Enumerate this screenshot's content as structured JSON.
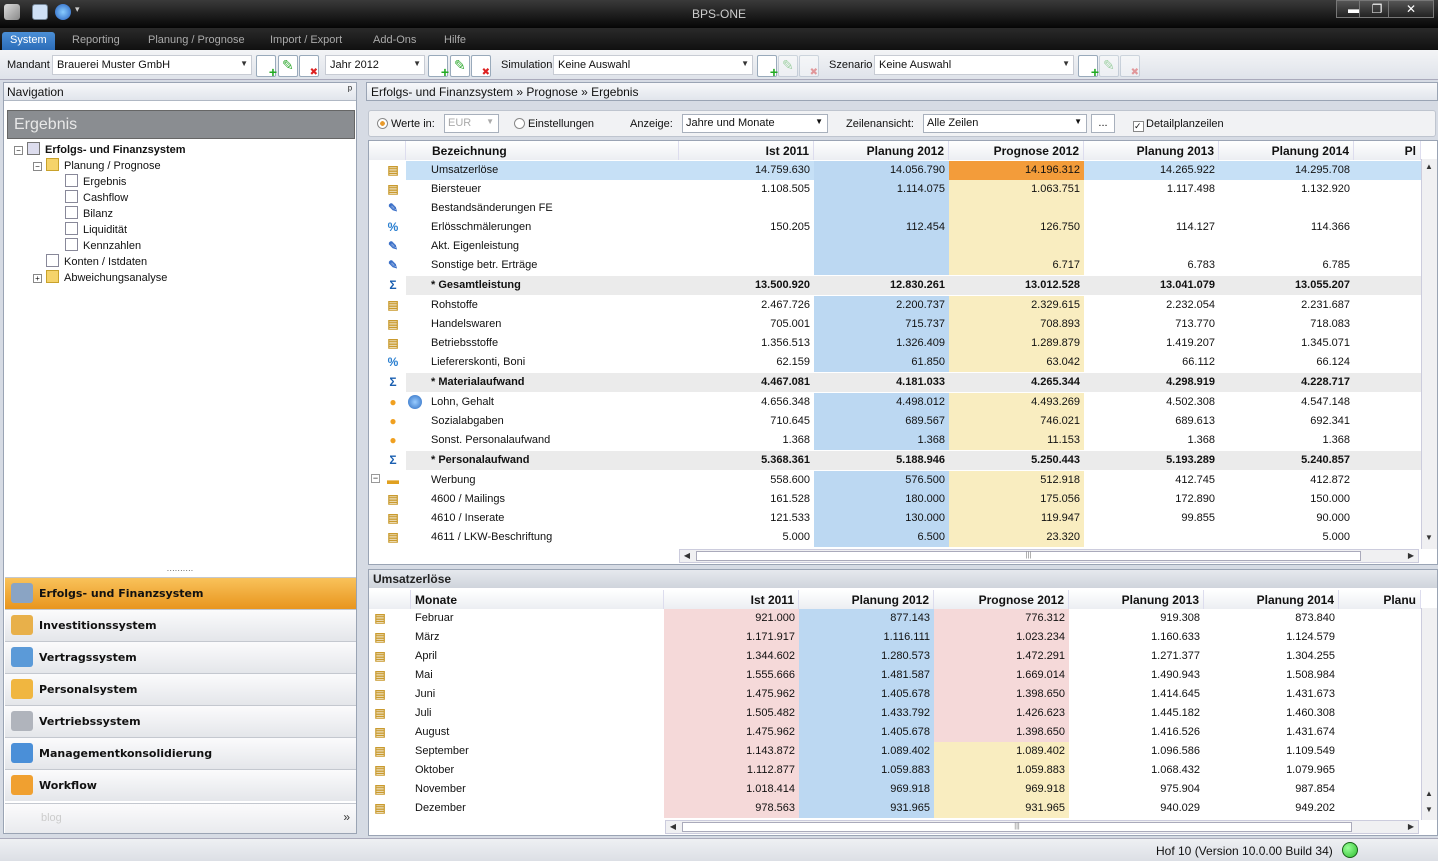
{
  "app": {
    "title": "BPS-ONE"
  },
  "window_controls": {
    "minimize": "▬",
    "maximize": "❐",
    "close": "✕"
  },
  "menu": {
    "tabs": [
      "System",
      "Reporting",
      "Planung / Prognose",
      "Import / Export",
      "Add-Ons",
      "Hilfe"
    ],
    "active": "System"
  },
  "toolbar": {
    "mandant_label": "Mandant",
    "mandant_value": "Brauerei Muster GmbH",
    "jahr_value": "Jahr 2012",
    "simulation_label": "Simulation",
    "simulation_value": "Keine Auswahl",
    "szenario_label": "Szenario",
    "szenario_value": "Keine Auswahl"
  },
  "navigation": {
    "header": "Navigation",
    "pin": "ᵖ",
    "title": "Ergebnis",
    "tree": [
      {
        "label": "Erfolgs- und Finanzsystem",
        "level": 0,
        "type": "root",
        "expander": "−",
        "bold": true
      },
      {
        "label": "Planung / Prognose",
        "level": 1,
        "type": "folder",
        "expander": "−"
      },
      {
        "label": "Ergebnis",
        "level": 2,
        "type": "doc"
      },
      {
        "label": "Cashflow",
        "level": 2,
        "type": "doc"
      },
      {
        "label": "Bilanz",
        "level": 2,
        "type": "doc"
      },
      {
        "label": "Liquidität",
        "level": 2,
        "type": "doc"
      },
      {
        "label": "Kennzahlen",
        "level": 2,
        "type": "doc"
      },
      {
        "label": "Konten / Istdaten",
        "level": 1,
        "type": "doc"
      },
      {
        "label": "Abweichungsanalyse",
        "level": 1,
        "type": "folder",
        "expander": "+"
      }
    ],
    "splitter_grip": "··········",
    "modules": [
      {
        "label": "Erfolgs- und Finanzsystem",
        "icon": "chart-icon",
        "color": "#8aa4c4",
        "active": true
      },
      {
        "label": "Investitionssystem",
        "icon": "clipboard-icon",
        "color": "#e8b04a"
      },
      {
        "label": "Vertragssystem",
        "icon": "contract-icon",
        "color": "#5b9ad8"
      },
      {
        "label": "Personalsystem",
        "icon": "people-icon",
        "color": "#f0b640"
      },
      {
        "label": "Vertriebssystem",
        "icon": "sales-icon",
        "color": "#b0b4bc"
      },
      {
        "label": "Managementkonsolidierung",
        "icon": "globe-icon",
        "color": "#4a8fd8"
      },
      {
        "label": "Workflow",
        "icon": "gears-icon",
        "color": "#f0a030"
      }
    ],
    "blog_label": "blog",
    "more_label": "»"
  },
  "breadcrumb": "Erfolgs- und Finanzsystem » Prognose » Ergebnis",
  "options": {
    "werte_label": "Werte in:",
    "currency": "EUR",
    "einstellungen_label": "Einstellungen",
    "anzeige_label": "Anzeige:",
    "anzeige_value": "Jahre und Monate",
    "zeilenansicht_label": "Zeilenansicht:",
    "zeilenansicht_value": "Alle Zeilen",
    "more_button": "...",
    "detail_label": "Detailplanzeilen",
    "detail_checked": true
  },
  "upper_grid": {
    "columns": [
      "Bezeichnung",
      "Ist 2011",
      "Planung 2012",
      "Prognose 2012",
      "Planung 2013",
      "Planung 2014",
      "Pl"
    ],
    "rows": [
      {
        "icon": "doc",
        "label": "Umsatzerlöse",
        "values": [
          "14.759.630",
          "14.056.790",
          "14.196.312",
          "14.265.922",
          "14.295.708"
        ],
        "selected": true
      },
      {
        "icon": "doc",
        "label": "Biersteuer",
        "values": [
          "1.108.505",
          "1.114.075",
          "1.063.751",
          "1.117.498",
          "1.132.920"
        ]
      },
      {
        "icon": "pencil",
        "label": "Bestandsänderungen FE",
        "values": [
          "",
          "",
          "",
          "",
          ""
        ]
      },
      {
        "icon": "percent",
        "label": "Erlösschmälerungen",
        "values": [
          "150.205",
          "112.454",
          "126.750",
          "114.127",
          "114.366"
        ]
      },
      {
        "icon": "pencil",
        "label": "Akt. Eigenleistung",
        "values": [
          "",
          "",
          "",
          "",
          ""
        ]
      },
      {
        "icon": "pencil",
        "label": "Sonstige betr. Erträge",
        "values": [
          "",
          "",
          "6.717",
          "6.783",
          "6.785"
        ]
      },
      {
        "icon": "sigma",
        "label": "* Gesamtleistung",
        "values": [
          "13.500.920",
          "12.830.261",
          "13.012.528",
          "13.041.079",
          "13.055.207"
        ],
        "sum": true
      },
      {
        "icon": "doc",
        "label": "Rohstoffe",
        "values": [
          "2.467.726",
          "2.200.737",
          "2.329.615",
          "2.232.054",
          "2.231.687"
        ]
      },
      {
        "icon": "doc",
        "label": "Handelswaren",
        "values": [
          "705.001",
          "715.737",
          "708.893",
          "713.770",
          "718.083"
        ]
      },
      {
        "icon": "doc",
        "label": "Betriebsstoffe",
        "values": [
          "1.356.513",
          "1.326.409",
          "1.289.879",
          "1.419.207",
          "1.345.071"
        ]
      },
      {
        "icon": "percent",
        "label": "Liefererskonti, Boni",
        "values": [
          "62.159",
          "61.850",
          "63.042",
          "66.112",
          "66.124"
        ]
      },
      {
        "icon": "sigma",
        "label": "* Materialaufwand",
        "values": [
          "4.467.081",
          "4.181.033",
          "4.265.344",
          "4.298.919",
          "4.228.717"
        ],
        "sum": true
      },
      {
        "icon": "people",
        "label": "Lohn, Gehalt",
        "values": [
          "4.656.348",
          "4.498.012",
          "4.493.269",
          "4.502.308",
          "4.547.148"
        ],
        "globe": true
      },
      {
        "icon": "people",
        "label": "Sozialabgaben",
        "values": [
          "710.645",
          "689.567",
          "746.021",
          "689.613",
          "692.341"
        ]
      },
      {
        "icon": "people",
        "label": "Sonst. Personalaufwand",
        "values": [
          "1.368",
          "1.368",
          "11.153",
          "1.368",
          "1.368"
        ]
      },
      {
        "icon": "sigma",
        "label": "* Personalaufwand",
        "values": [
          "5.368.361",
          "5.188.946",
          "5.250.443",
          "5.193.289",
          "5.240.857"
        ],
        "sum": true
      },
      {
        "icon": "folder",
        "label": "Werbung",
        "values": [
          "558.600",
          "576.500",
          "512.918",
          "412.745",
          "412.872"
        ],
        "expander": "−"
      },
      {
        "icon": "doc",
        "label": "4600 / Mailings",
        "values": [
          "161.528",
          "180.000",
          "175.056",
          "172.890",
          "150.000"
        ]
      },
      {
        "icon": "doc",
        "label": "4610 / Inserate",
        "values": [
          "121.533",
          "130.000",
          "119.947",
          "99.855",
          "90.000"
        ]
      },
      {
        "icon": "doc",
        "label": "4611 / LKW-Beschriftung",
        "values": [
          "5.000",
          "6.500",
          "23.320",
          "",
          "5.000"
        ]
      }
    ]
  },
  "lower_grid": {
    "title": "Umsatzerlöse",
    "columns": [
      "Monate",
      "Ist 2011",
      "Planung 2012",
      "Prognose 2012",
      "Planung 2013",
      "Planung 2014",
      "Planu"
    ],
    "rows": [
      {
        "label": "Februar",
        "values": [
          "921.000",
          "877.143",
          "776.312",
          "919.308",
          "873.840"
        ],
        "prognose_actual": true
      },
      {
        "label": "März",
        "values": [
          "1.171.917",
          "1.116.111",
          "1.023.234",
          "1.160.633",
          "1.124.579"
        ],
        "prognose_actual": true
      },
      {
        "label": "April",
        "values": [
          "1.344.602",
          "1.280.573",
          "1.472.291",
          "1.271.377",
          "1.304.255"
        ],
        "prognose_actual": true
      },
      {
        "label": "Mai",
        "values": [
          "1.555.666",
          "1.481.587",
          "1.669.014",
          "1.490.943",
          "1.508.984"
        ],
        "prognose_actual": true
      },
      {
        "label": "Juni",
        "values": [
          "1.475.962",
          "1.405.678",
          "1.398.650",
          "1.414.645",
          "1.431.673"
        ],
        "prognose_actual": true
      },
      {
        "label": "Juli",
        "values": [
          "1.505.482",
          "1.433.792",
          "1.426.623",
          "1.445.182",
          "1.460.308"
        ],
        "prognose_actual": true
      },
      {
        "label": "August",
        "values": [
          "1.475.962",
          "1.405.678",
          "1.398.650",
          "1.416.526",
          "1.431.674"
        ],
        "prognose_actual": true
      },
      {
        "label": "September",
        "values": [
          "1.143.872",
          "1.089.402",
          "1.089.402",
          "1.096.586",
          "1.109.549"
        ]
      },
      {
        "label": "Oktober",
        "values": [
          "1.112.877",
          "1.059.883",
          "1.059.883",
          "1.068.432",
          "1.079.965"
        ]
      },
      {
        "label": "November",
        "values": [
          "1.018.414",
          "969.918",
          "969.918",
          "975.904",
          "987.854"
        ]
      },
      {
        "label": "Dezember",
        "values": [
          "978.563",
          "931.965",
          "931.965",
          "940.029",
          "949.202"
        ]
      }
    ]
  },
  "status": {
    "text": "Hof 10 (Version 10.0.00 Build 34)",
    "indicator_color": "#2fbf2f"
  },
  "colors": {
    "planung_col": "#bcd8f2",
    "prognose_col": "#f9edc0",
    "ist_col_lower": "#f5d9d9",
    "prognose_actual": "#f5d9d9",
    "highlight": "#f39c3a",
    "selected_row": "#c6e0f6"
  }
}
